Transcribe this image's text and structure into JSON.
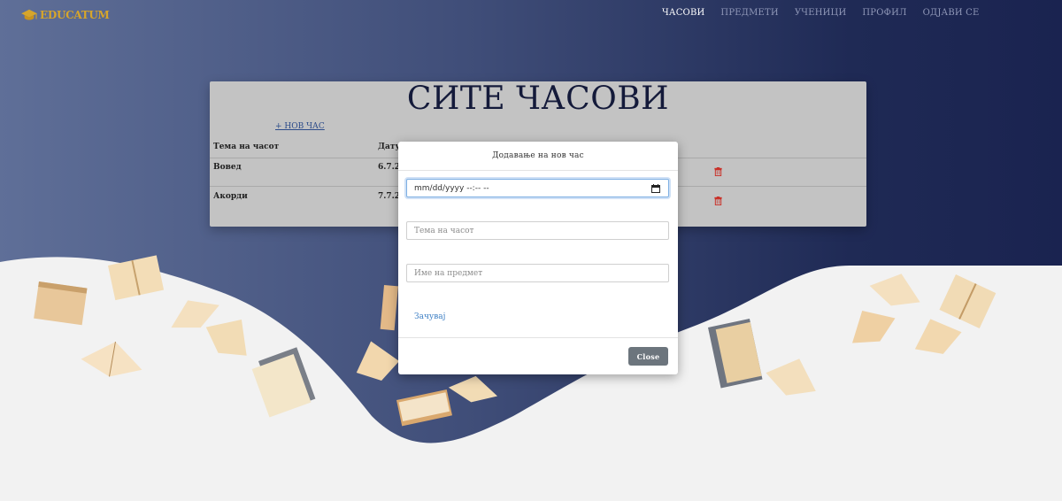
{
  "brand": {
    "name": "EDUCATUM",
    "icon": "graduation-cap-icon",
    "color": "#d6a52b"
  },
  "nav": {
    "items": [
      {
        "label": "ЧАСОВИ",
        "active": true
      },
      {
        "label": "ПРЕДМЕТИ",
        "active": false
      },
      {
        "label": "УЧЕНИЦИ",
        "active": false
      },
      {
        "label": "ПРОФИЛ",
        "active": false
      },
      {
        "label": "ОДЈАВИ СЕ",
        "active": false
      }
    ]
  },
  "page": {
    "title": "СИТЕ ЧАСОВИ",
    "new_link": "+ НОВ ЧАС",
    "columns": [
      "Тема на часот",
      "Дату"
    ],
    "rows": [
      {
        "topic": "Вовед",
        "date": "6.7.20"
      },
      {
        "topic": "Акорди",
        "date": "7.7.20"
      }
    ]
  },
  "modal": {
    "title": "Додавање на нов час",
    "datetime_placeholder": "mm/dd/yyyy --:-- --",
    "topic_placeholder": "Тема на часот",
    "subject_placeholder": "Име на предмет",
    "save_label": "Зачувај",
    "close_label": "Close"
  },
  "colors": {
    "accent": "#6c757d",
    "link": "#3d7fc4",
    "trash": "#c9332b"
  }
}
